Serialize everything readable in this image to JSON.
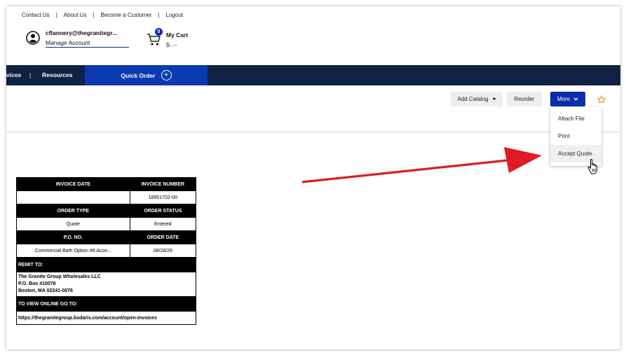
{
  "header": {
    "links": [
      "Contact Us",
      "About Us",
      "Become a Customer",
      "Logout"
    ],
    "user_email": "cflannery@thegranitegr...",
    "manage_account": "Manage Account",
    "cart_count": "0",
    "cart_title": "My Cart",
    "cart_total": "$-.--"
  },
  "nav": {
    "items": [
      "vices",
      "Resources"
    ],
    "separator": "|",
    "quick_order": "Quick Order",
    "quick_order_plus": "+"
  },
  "actions": {
    "add_catalog": "Add Catalog",
    "reorder": "Reorder",
    "more": "More",
    "star_icon": "star-icon"
  },
  "more_menu": {
    "items": [
      "Attach File",
      "Print",
      "Accept Quote"
    ],
    "hovered": "Accept Quote"
  },
  "invoice": {
    "invoice_date_label": "INVOICE DATE",
    "invoice_date": "",
    "invoice_number_label": "INVOICE NUMBER",
    "invoice_number": "18951702-00",
    "order_type_label": "ORDER TYPE",
    "order_type": "Quote",
    "order_status_label": "ORDER STATUS",
    "order_status": "Entered",
    "po_label": "P.O. NO.",
    "po": "Commercial Bath Option #6 Acce...",
    "order_date_label": "ORDER DATE",
    "order_date": "08/28/26",
    "remit_label": "REMIT TO:",
    "remit_lines": [
      "The Granite Group Wholesales LLC",
      "P.O. Box 410076",
      "Boston, MA 02241-0076"
    ],
    "online_label": "TO VIEW ONLINE GO TO:",
    "online_url": "https://thegranitegroup.kodaris.com/account/open-invoices"
  },
  "colors": {
    "navbar": "#0f2244",
    "quick_order": "#0b3ab0",
    "more_button": "#0b2ea8",
    "arrow": "#e01b24",
    "star": "#e0a21a"
  }
}
